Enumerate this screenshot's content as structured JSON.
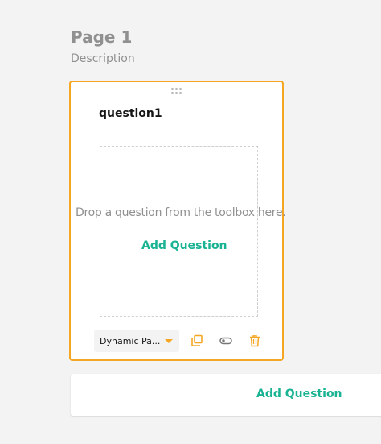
{
  "page": {
    "title": "Page 1",
    "description": "Description"
  },
  "question": {
    "name": "question1",
    "drop_text": "Drop a question from the toolbox here.",
    "add_question_label": "Add Question",
    "type_select_value": "Dynamic Pa...",
    "icons": {
      "drag": "drag-handle-icon",
      "duplicate": "duplicate-icon",
      "required_toggle": "toggle-icon",
      "delete": "trash-icon",
      "dropdown": "chevron-down-icon"
    }
  },
  "footer": {
    "add_question_label": "Add Question"
  },
  "colors": {
    "accent": "#f5a623",
    "brand_green": "#19b394",
    "muted_text": "#909090",
    "background": "#f3f3f3"
  }
}
